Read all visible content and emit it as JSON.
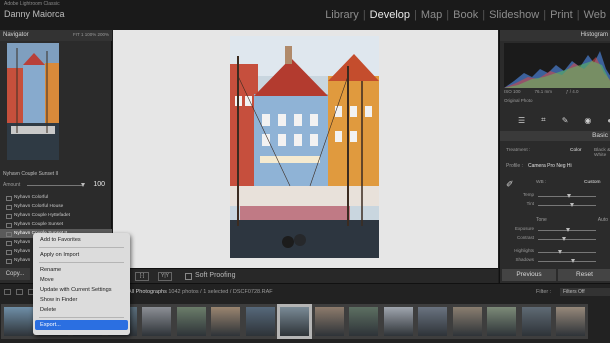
{
  "app": {
    "name": "Adobe Lightroom Classic",
    "user": "Danny Maiorca"
  },
  "modules": [
    "Library",
    "Develop",
    "Map",
    "Book",
    "Slideshow",
    "Print",
    "Web"
  ],
  "active_module": "Develop",
  "left_panel": {
    "navigator_title": "Navigator",
    "zoom_levels": "FIT  1  100%  200%",
    "preset_name": "Nyhavn Couple Sunset II",
    "amount_label": "Amount",
    "amount_value": "100",
    "presets": [
      "Nyhavn Colorful",
      "Nyhavn Colorful House",
      "Nyhavn Couple Hyttefadet",
      "Nyhavn Couple Sunset",
      "Nyhavn Couple Sunset II",
      "Nyhavn",
      "Nyhavn",
      "Nyhavn"
    ],
    "selected_preset_index": 4,
    "copy_label": "Copy..."
  },
  "context_menu": {
    "items": [
      {
        "label": "Add to Favorites"
      },
      {
        "label": "Apply on Import"
      },
      {
        "label": "Rename"
      },
      {
        "label": "Move"
      },
      {
        "label": "Update with Current Settings"
      },
      {
        "label": "Show in Finder"
      },
      {
        "label": "Delete"
      },
      {
        "label": "Export..."
      }
    ],
    "highlighted": "Export..."
  },
  "toolbar": {
    "view1": "[·]",
    "view2": "Y|Y",
    "soft_proofing": "Soft Proofing"
  },
  "right_panel": {
    "histogram_title": "Histogram",
    "iso": "ISO 100",
    "focal": "76.1 mm",
    "aperture": "ƒ / 4.0",
    "original_photo": "Original Photo",
    "basic_title": "Basic",
    "treatment_label": "Treatment :",
    "treatment_color": "Color",
    "treatment_bw": "Black & White",
    "profile_label": "Profile :",
    "profile_value": "Camera Pro Neg Hi",
    "wb_label": "WB :",
    "wb_value": "Custom",
    "sliders_wb": [
      {
        "label": "Temp",
        "position": 0.55
      },
      {
        "label": "Tint",
        "position": 0.6
      }
    ],
    "tone_label": "Tone",
    "tone_value": "Auto",
    "sliders_tone": [
      {
        "label": "Exposure",
        "position": 0.52
      },
      {
        "label": "Contrast",
        "position": 0.45
      },
      {
        "label": "Highlights",
        "position": 0.38
      },
      {
        "label": "Shadows",
        "position": 0.62
      }
    ],
    "previous_label": "Previous",
    "reset_label": "Reset"
  },
  "filmstrip": {
    "info_prefix": "All Photographs",
    "info_text": "1042 photos / 1 selected / DSCF0728.RAF",
    "filter_label": "Filter :",
    "filter_value": "Filters Off"
  },
  "colors": {
    "accent_highlight": "#2b6fe1",
    "panel_bg": "#2b2b2b"
  }
}
